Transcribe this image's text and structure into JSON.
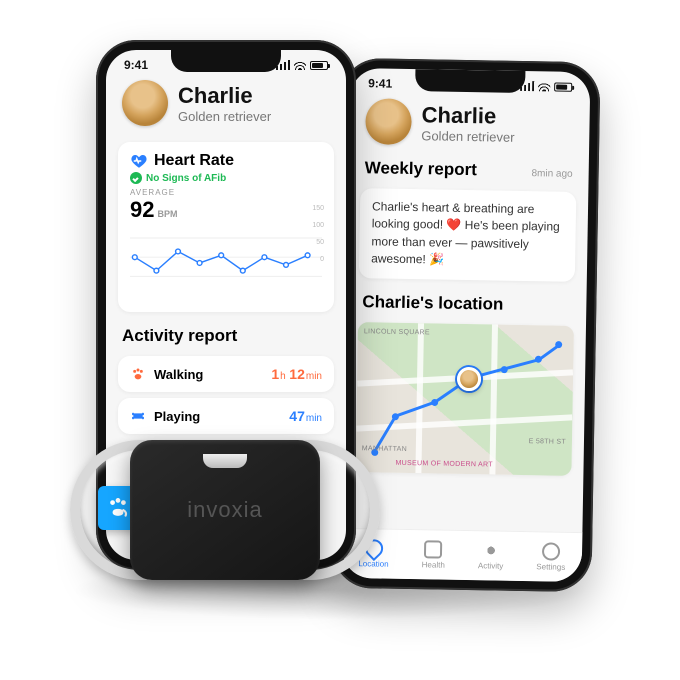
{
  "status_time": "9:41",
  "pet": {
    "name": "Charlie",
    "breed": "Golden retriever"
  },
  "heart_rate": {
    "title": "Heart Rate",
    "status": "No Signs of AFib",
    "avg_label": "AVERAGE",
    "avg_value": "92",
    "avg_unit": "BPM",
    "y_ticks": [
      "150",
      "100",
      "50",
      "0"
    ]
  },
  "chart_data": {
    "type": "line",
    "title": "Heart Rate",
    "ylabel": "BPM",
    "ylim": [
      0,
      150
    ],
    "x": [
      0,
      1,
      2,
      3,
      4,
      5,
      6,
      7,
      8
    ],
    "values": [
      95,
      60,
      110,
      80,
      100,
      60,
      95,
      75,
      100
    ]
  },
  "activity": {
    "title": "Activity report",
    "items": [
      {
        "icon": "paw",
        "label": "Walking",
        "hours": "1",
        "mins": "12",
        "color": "#ff6a3d"
      },
      {
        "icon": "bone",
        "label": "Playing",
        "hours": "",
        "mins": "47",
        "color": "#2a7fff"
      }
    ]
  },
  "weekly": {
    "title": "Weekly report",
    "ago": "8min ago",
    "body": "Charlie's heart & breathing are looking good! ❤️ He's been playing more than ever — pawsitively awesome! 🎉"
  },
  "location": {
    "title": "Charlie's location"
  },
  "map_labels": {
    "a": "LINCOLN SQUARE",
    "b": "MANHATTAN",
    "c": "Museum of Modern Art",
    "d": "E 58TH ST"
  },
  "tabs": [
    {
      "label": "Location"
    },
    {
      "label": "Health"
    },
    {
      "label": "Activity"
    },
    {
      "label": "Settings"
    }
  ],
  "device_brand": "invoxia"
}
